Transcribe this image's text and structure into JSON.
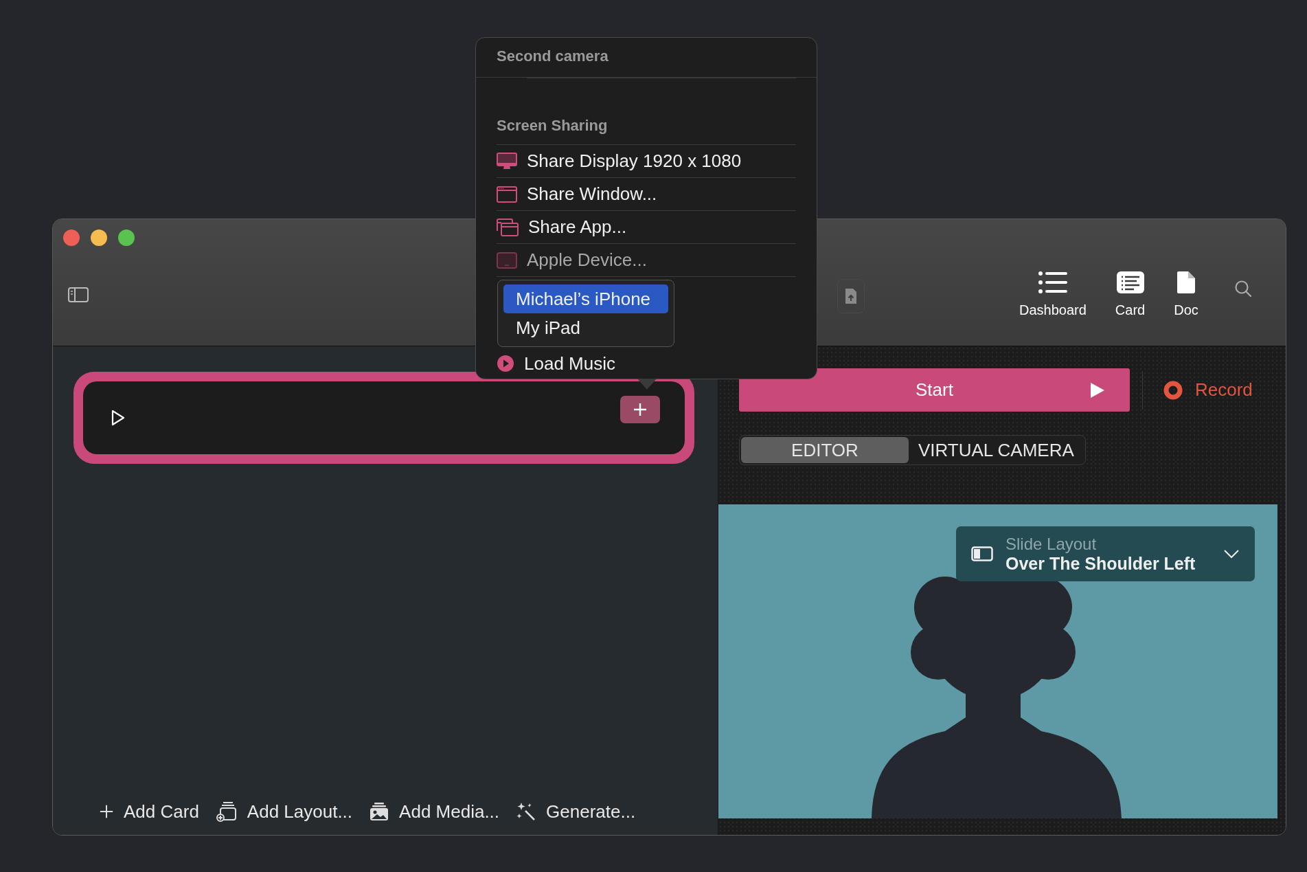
{
  "window": {
    "toolbar": [
      {
        "label": "Dashboard",
        "kind": "list"
      },
      {
        "label": "Card",
        "kind": "card"
      },
      {
        "label": "Doc",
        "kind": "doc"
      }
    ]
  },
  "source_menu": {
    "sections": [
      {
        "title": "Second camera"
      },
      {
        "title": "Screen Sharing",
        "items": [
          {
            "label": "Share Display 1920 x 1080",
            "kind": "display",
            "disabled": false
          },
          {
            "label": "Share Window...",
            "kind": "window",
            "disabled": false
          },
          {
            "label": "Share App...",
            "kind": "app",
            "disabled": false
          },
          {
            "label": "Apple Device...",
            "kind": "device",
            "disabled": true
          },
          {
            "label": "Load Music",
            "kind": "music",
            "disabled": false
          }
        ]
      }
    ]
  },
  "device_submenu": {
    "items": [
      {
        "label": "Michael’s iPhone",
        "selected": true
      },
      {
        "label": "My iPad",
        "selected": false
      }
    ]
  },
  "start_button": "Start",
  "record_button": "Record",
  "mode_tabs": [
    {
      "label": "EDITOR",
      "selected": true
    },
    {
      "label": "VIRTUAL CAMERA",
      "selected": false
    }
  ],
  "layout_picker": {
    "label": "Slide Layout",
    "value": "Over The Shoulder Left"
  },
  "bottom_toolbar": [
    {
      "label": "Add Card",
      "kind": "plus"
    },
    {
      "label": "Add Layout...",
      "kind": "layout"
    },
    {
      "label": "Add Media...",
      "kind": "media"
    },
    {
      "label": "Generate...",
      "kind": "sparkle"
    }
  ]
}
